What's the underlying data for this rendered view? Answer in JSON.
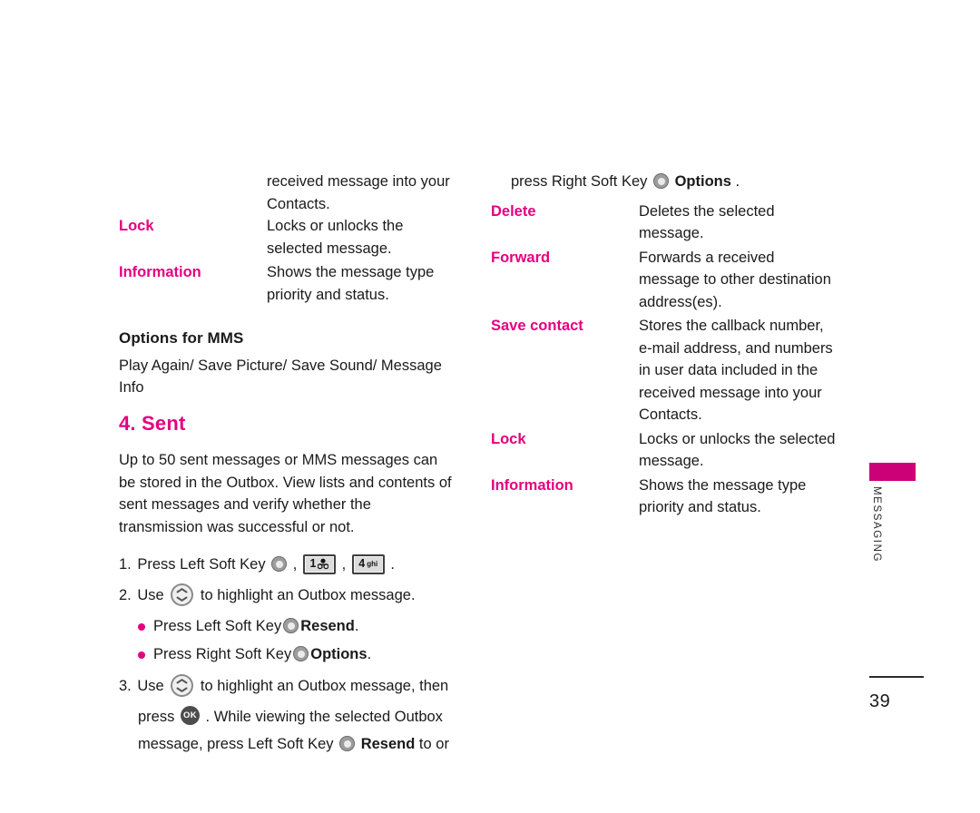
{
  "document": {
    "page_number": "39",
    "section_tab": "MESSAGING",
    "accent_magenta": "#e4007f",
    "tab_magenta": "#cc0077"
  },
  "left_column": {
    "continued_desc": "received message into your Contacts.",
    "definitions": [
      {
        "term": "Lock",
        "desc": "Locks or unlocks the selected message."
      },
      {
        "term": "Information",
        "desc": "Shows the message type priority and status."
      }
    ],
    "mms_heading": "Options for MMS",
    "mms_options": "Play Again/ Save Picture/ Save Sound/ Message Info",
    "section_heading": "4. Sent",
    "section_paragraph": "Up to 50 sent messages or MMS messages can be stored in the Outbox. View lists and contents of sent messages and verify whether the transmission was successful or not.",
    "steps": [
      {
        "num": "1.",
        "text_before": "Press Left Soft Key",
        "icon1": "soft-key-icon",
        "sep1": ",",
        "icon2": "keypad-1-voicemail-icon",
        "key2_digit": "1",
        "sep2": ",",
        "icon3": "keypad-4-ghi-icon",
        "key3_digit": "4",
        "key3_letters": "ghi",
        "text_after": "."
      },
      {
        "num": "2.",
        "text_before": "Use",
        "icon1": "navigation-key-icon",
        "text_after": "to highlight an Outbox message."
      }
    ],
    "bullets": [
      {
        "text_before": "Press Left Soft Key",
        "icon": "soft-key-icon",
        "label": "Resend",
        "text_after": "."
      },
      {
        "text_before": "Press Right Soft Key",
        "icon": "soft-key-icon",
        "label": "Options",
        "text_after": "."
      }
    ],
    "step3": {
      "num": "3.",
      "text_a": "Use",
      "icon_nav": "navigation-key-icon",
      "text_b": "to highlight an Outbox message, then",
      "text_c": "press",
      "icon_ok": "ok-key-icon",
      "ok_label": "OK",
      "text_d": ". While viewing the selected Outbox",
      "text_e": "message, press Left Soft Key",
      "icon_soft": "soft-key-icon",
      "label_resend": "Resend",
      "text_f": "to or"
    }
  },
  "right_column": {
    "intro": {
      "text_before": "press Right Soft Key",
      "icon": "soft-key-icon",
      "label": "Options",
      "text_after": "."
    },
    "definitions": [
      {
        "term": "Delete",
        "desc": "Deletes the selected message."
      },
      {
        "term": "Forward",
        "desc": "Forwards a received message to other destination address(es)."
      },
      {
        "term": "Save contact",
        "desc": "Stores the callback number, e-mail address, and numbers in user data included in the received message into your Contacts."
      },
      {
        "term": "Lock",
        "desc": "Locks or unlocks the selected message."
      },
      {
        "term": "Information",
        "desc": "Shows the message type priority and status."
      }
    ]
  }
}
